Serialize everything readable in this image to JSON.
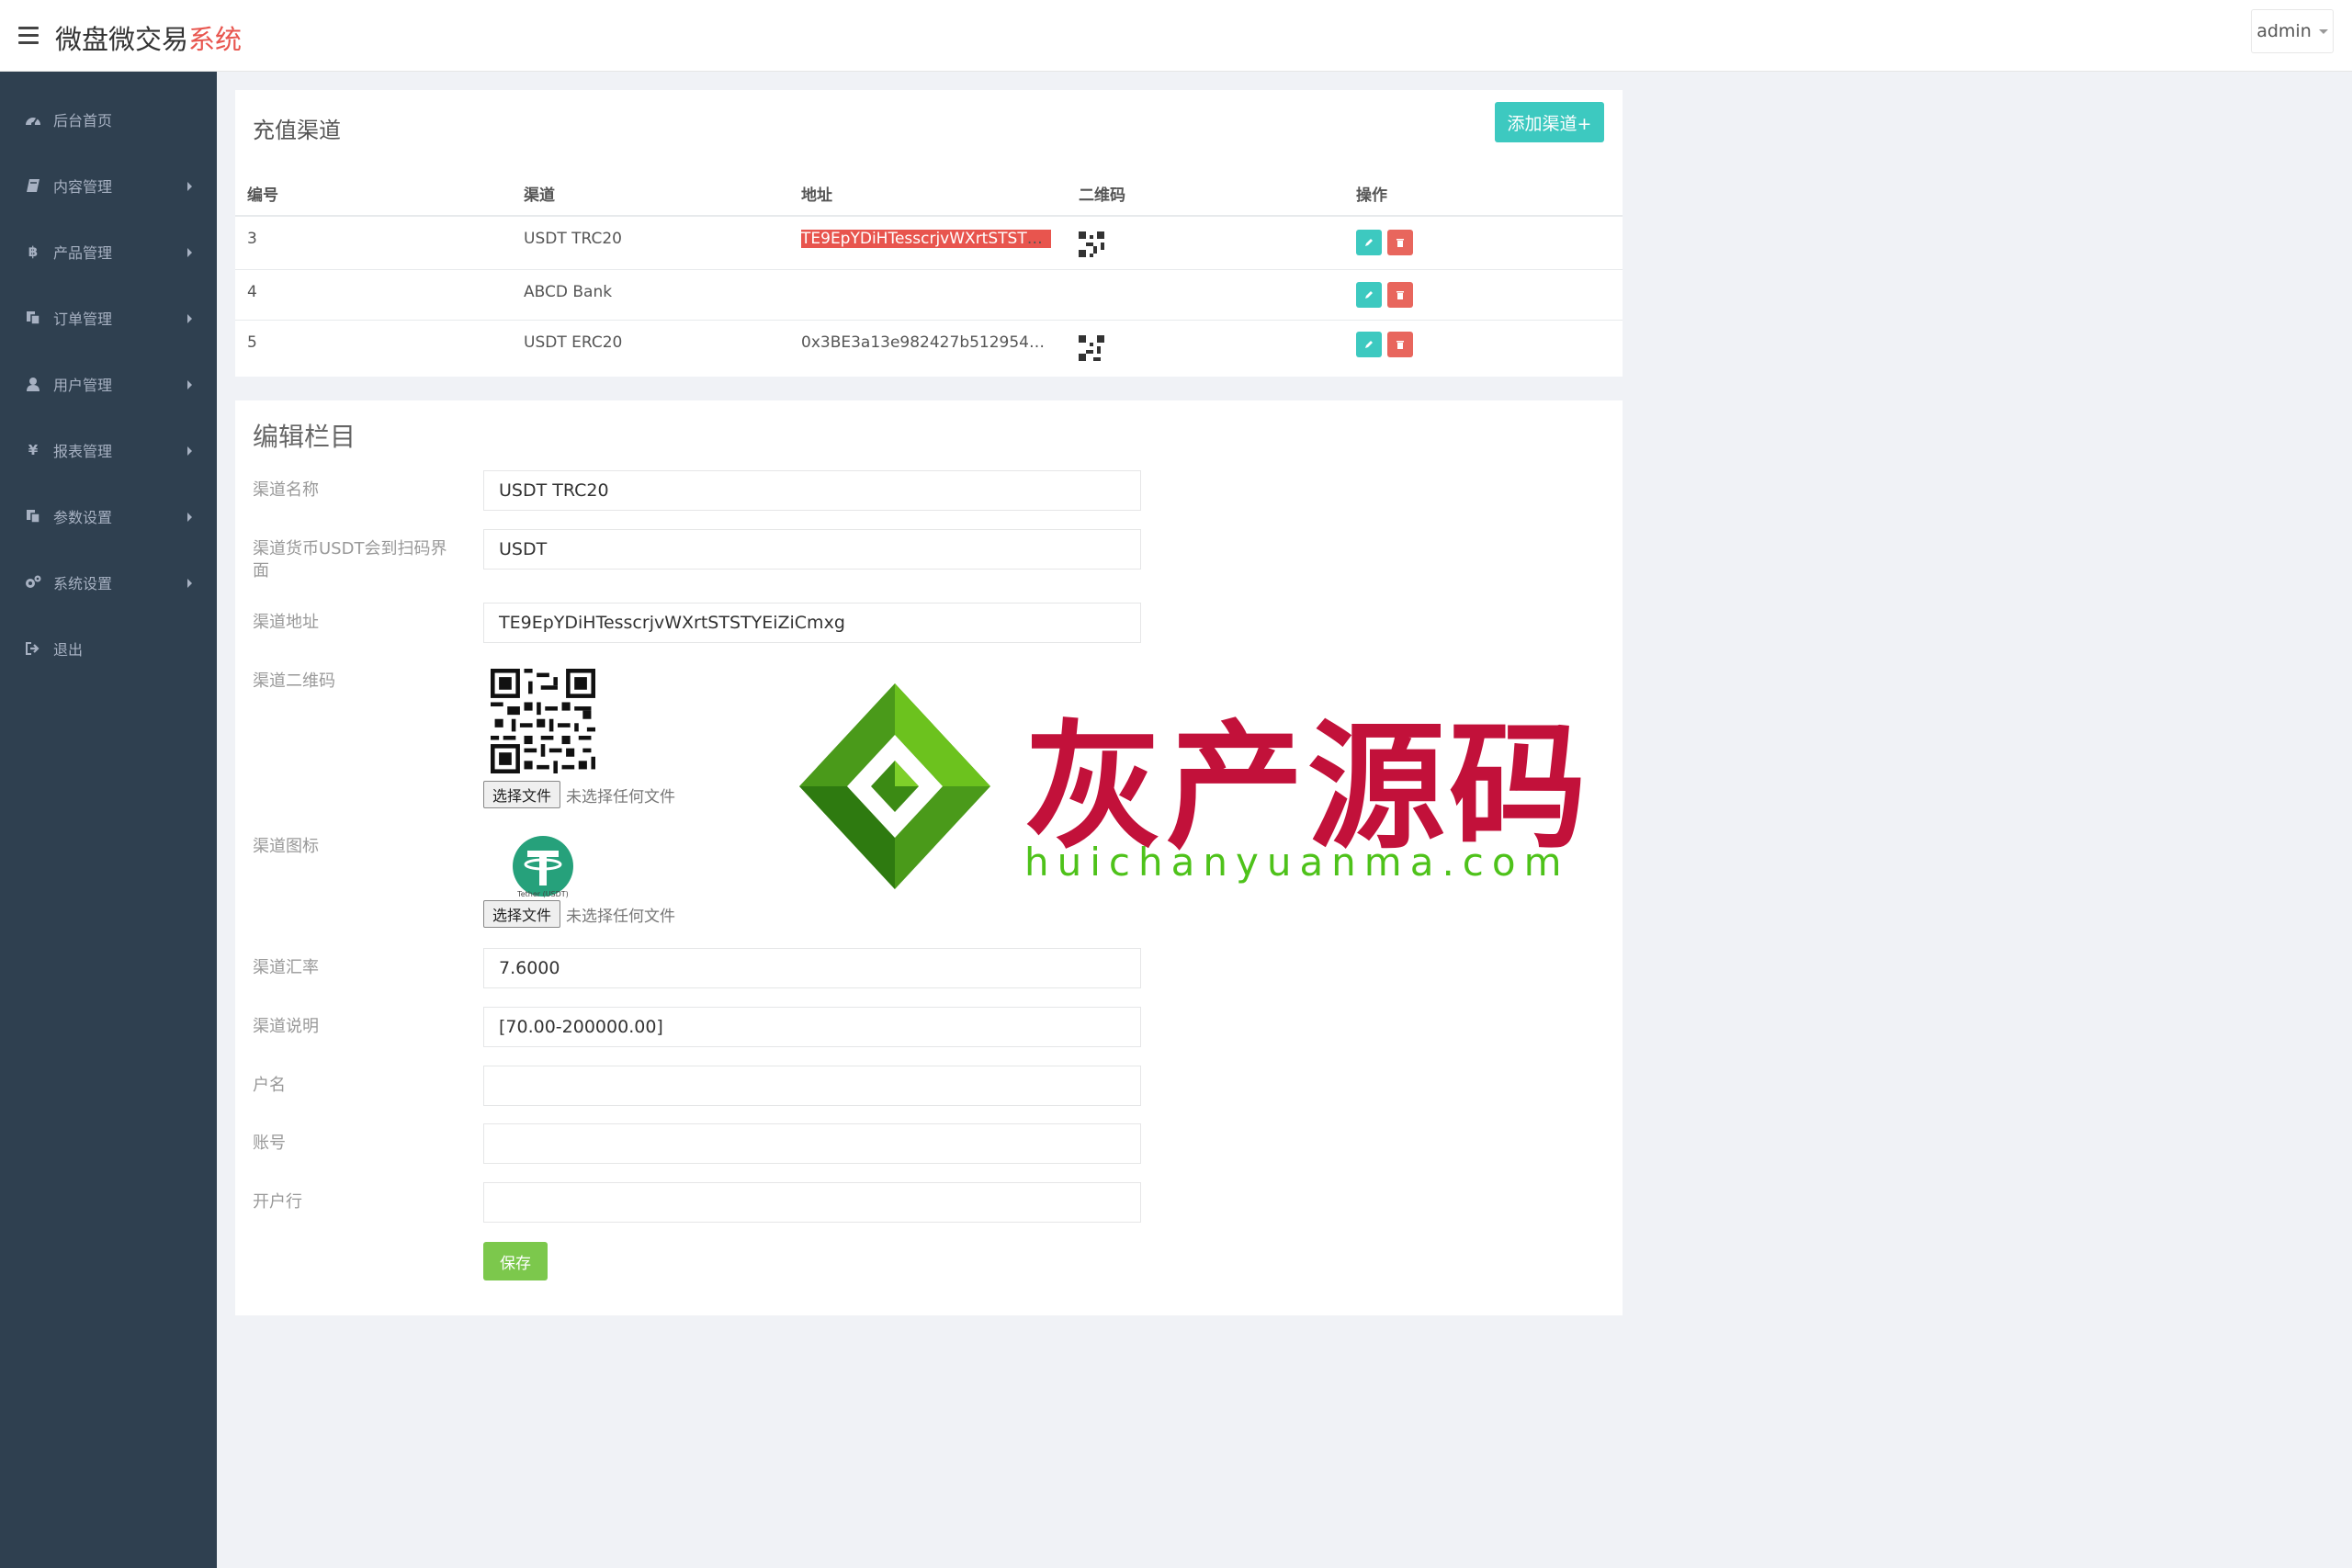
{
  "header": {
    "brand_main": "微盘微交易",
    "brand_accent": "系统",
    "user": "admin"
  },
  "sidebar": {
    "items": [
      {
        "label": "后台首页",
        "icon": "dashboard-icon",
        "has_arrow": false
      },
      {
        "label": "内容管理",
        "icon": "book-icon",
        "has_arrow": true
      },
      {
        "label": "产品管理",
        "icon": "bitcoin-icon",
        "has_arrow": true
      },
      {
        "label": "订单管理",
        "icon": "copy-icon",
        "has_arrow": true
      },
      {
        "label": "用户管理",
        "icon": "user-icon",
        "has_arrow": true
      },
      {
        "label": "报表管理",
        "icon": "yen-icon",
        "has_arrow": true
      },
      {
        "label": "参数设置",
        "icon": "copy-icon",
        "has_arrow": true
      },
      {
        "label": "系统设置",
        "icon": "cogs-icon",
        "has_arrow": true
      },
      {
        "label": "退出",
        "icon": "sign-out-icon",
        "has_arrow": false
      }
    ]
  },
  "channels": {
    "title": "充值渠道",
    "add_label": "添加渠道+",
    "columns": [
      "编号",
      "渠道",
      "地址",
      "二维码",
      "操作"
    ],
    "rows": [
      {
        "id": "3",
        "name": "USDT TRC20",
        "address": "TE9EpYDiHTesscrjvWXrtSTSTYEi...",
        "has_qr": true
      },
      {
        "id": "4",
        "name": "ABCD Bank",
        "address": "",
        "has_qr": false
      },
      {
        "id": "5",
        "name": "USDT ERC20",
        "address": "0x3BE3a13e982427b512954Fd1...",
        "has_qr": true
      }
    ]
  },
  "edit_form": {
    "title": "编辑栏目",
    "fields": {
      "name_label": "渠道名称",
      "name_value": "USDT TRC20",
      "currency_label": "渠道货币USDT会到扫码界面",
      "currency_value": "USDT",
      "address_label": "渠道地址",
      "address_value": "TE9EpYDiHTesscrjvWXrtSTSTYEiZiCmxg",
      "qrcode_label": "渠道二维码",
      "icon_label": "渠道图标",
      "icon_caption": "Tether (USDT)",
      "rate_label": "渠道汇率",
      "rate_value": "7.6000",
      "desc_label": "渠道说明",
      "desc_value": "[70.00-200000.00]",
      "account_name_label": "户名",
      "account_name_value": "",
      "account_no_label": "账号",
      "account_no_value": "",
      "bank_label": "开户行",
      "bank_value": ""
    },
    "file_button": "选择文件",
    "file_status": "未选择任何文件",
    "save_label": "保存"
  },
  "watermark": {
    "text": "灰产源码",
    "url": "huichanyuanma.com"
  },
  "colors": {
    "sidebar_bg": "#2f4050",
    "accent_teal": "#3dc9c0",
    "danger": "#e8665d",
    "save_green": "#7cc84c",
    "brand_red": "#e8554e"
  }
}
